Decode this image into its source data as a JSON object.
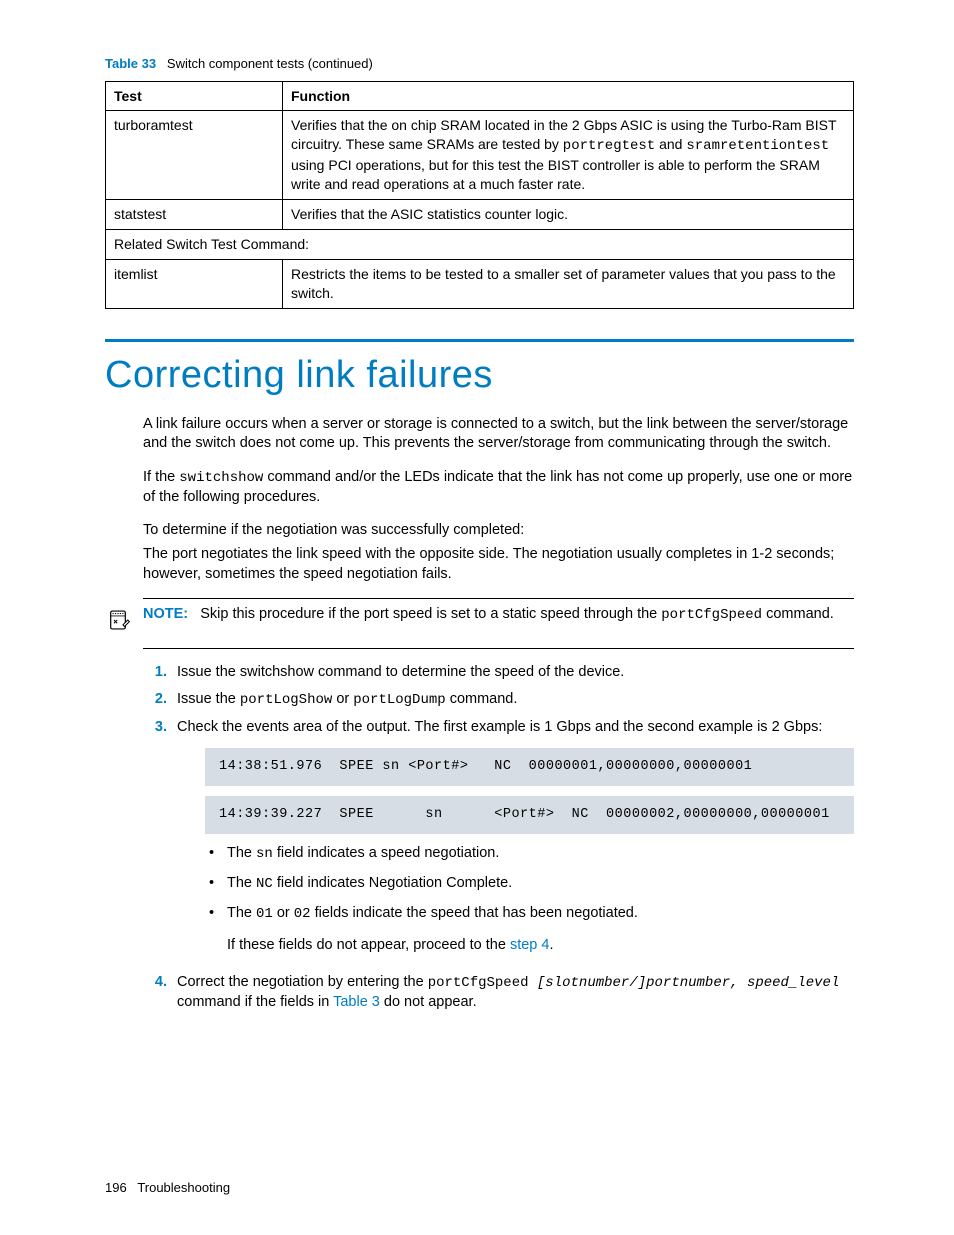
{
  "table": {
    "caption_label": "Table 33",
    "caption_text": "Switch component tests (continued)",
    "header_test": "Test",
    "header_function": "Function",
    "row1_test": "turboramtest",
    "row1_func_a": "Verifies that the on chip SRAM located in the 2 Gbps ASIC is using the Turbo-Ram BIST circuitry. These same SRAMs are tested by ",
    "row1_func_code1": "portregtest",
    "row1_func_mid": " and ",
    "row1_func_code2": "sramretentiontest",
    "row1_func_b": " using PCI operations, but for this test the BIST controller is able to perform the SRAM write and read operations at a much faster rate.",
    "row2_test": "statstest",
    "row2_func": "Verifies that the ASIC statistics counter logic.",
    "row3_span": "Related Switch Test Command:",
    "row4_test": "itemlist",
    "row4_func": "Restricts the items to be tested to a smaller set of parameter values that you pass to the switch."
  },
  "section_title": "Correcting link failures",
  "para1": "A link failure occurs when a server or storage is connected to a switch, but the link between the server/storage and the switch does not come up. This prevents the server/storage from communicating through the switch.",
  "para2_a": "If the ",
  "para2_code": "switchshow",
  "para2_b": " command and/or the LEDs indicate that the link has not come up properly, use one or more of the following procedures.",
  "para3": "To determine if the negotiation was successfully completed:",
  "para4": "The port negotiates the link speed with the opposite side. The negotiation usually completes in 1-2 seconds; however, sometimes the speed negotiation fails.",
  "note": {
    "label": "NOTE:",
    "text_a": "Skip this procedure if the port speed is set to a static speed through the ",
    "text_code": "portCfgSpeed",
    "text_b": " command."
  },
  "steps": {
    "s1": "Issue the switchshow command to determine the speed of the device.",
    "s2_a": "Issue the ",
    "s2_code1": "portLogShow",
    "s2_mid": " or ",
    "s2_code2": "portLogDump",
    "s2_b": " command.",
    "s3": "Check the events area of the output. The first example is 1 Gbps and the second example is 2 Gbps:",
    "code1": "14:38:51.976  SPEE sn <Port#>   NC  00000001,00000000,00000001",
    "code2": "14:39:39.227  SPEE      sn      <Port#>  NC  00000002,00000000,00000001",
    "b1_a": "The ",
    "b1_code": "sn",
    "b1_b": " field indicates a speed negotiation.",
    "b2_a": "The ",
    "b2_code": "NC",
    "b2_b": " field indicates Negotiation Complete.",
    "b3_a": "The ",
    "b3_code1": "01",
    "b3_mid": " or ",
    "b3_code2": "02",
    "b3_b": " fields indicate the speed that has been negotiated.",
    "b_after_a": "If these fields do not appear, proceed to the ",
    "b_after_link": "step 4",
    "b_after_b": ".",
    "s4_a": "Correct the negotiation by entering the ",
    "s4_code": "portCfgSpeed ",
    "s4_it": "[slotnumber/]portnumber, speed_level",
    "s4_b": " command if the fields in ",
    "s4_link": "Table 3",
    "s4_c": " do not appear."
  },
  "footer_page": "196",
  "footer_text": "Troubleshooting"
}
